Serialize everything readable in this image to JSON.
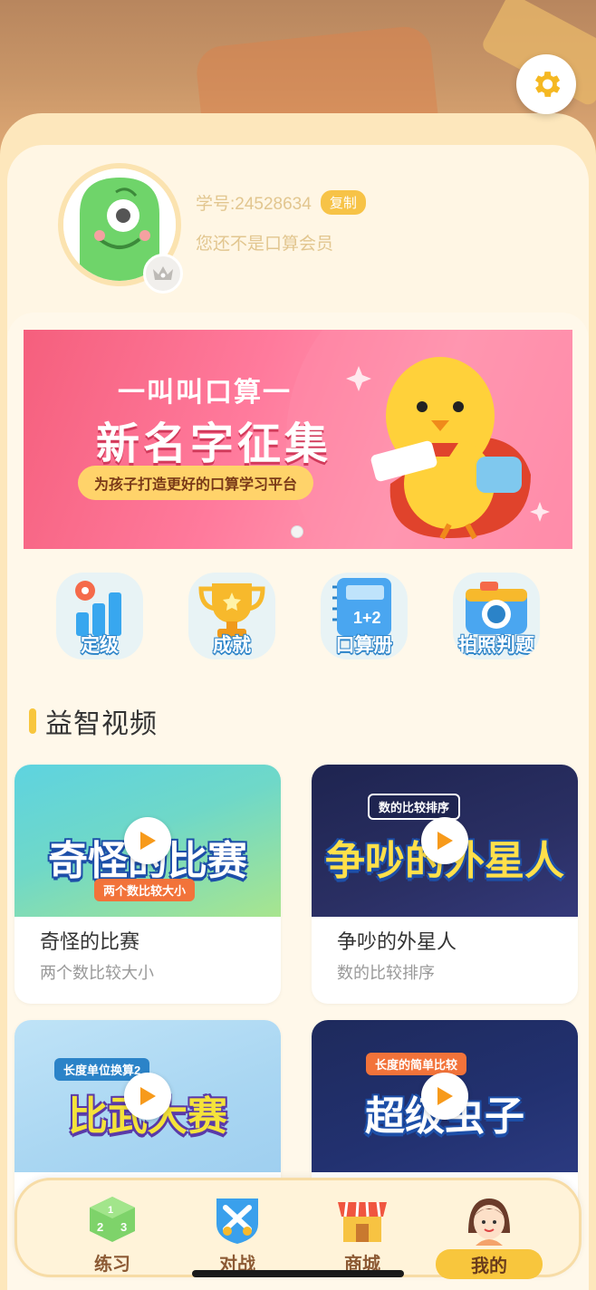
{
  "header": {
    "settings_icon": "gear-icon"
  },
  "profile": {
    "student_id": "学号:24528634",
    "copy_label": "复制",
    "member_status": "您还不是口算会员"
  },
  "banner": {
    "subtitle": "一叫叫口算一",
    "title": "新名字征集",
    "tagline": "为孩子打造更好的口算学习平台"
  },
  "shortcuts": [
    {
      "label": "定级",
      "icon": "level-chart-icon"
    },
    {
      "label": "成就",
      "icon": "trophy-icon"
    },
    {
      "label": "口算册",
      "icon": "notebook-icon"
    },
    {
      "label": "拍照判题",
      "icon": "camera-icon"
    }
  ],
  "section": {
    "title": "益智视频"
  },
  "videos": [
    {
      "thumb_title": "奇怪的比赛",
      "thumb_sub": "两个数比较大小",
      "name": "奇怪的比赛",
      "desc": "两个数比较大小"
    },
    {
      "thumb_title": "争吵的外星人",
      "thumb_sub": "数的比较排序",
      "name": "争吵的外星人",
      "desc": "数的比较排序"
    },
    {
      "thumb_title": "比武大赛",
      "thumb_sub": "长度单位换算2",
      "name": "",
      "desc": ""
    },
    {
      "thumb_title": "超级虫子",
      "thumb_sub": "长度的简单比较",
      "name": "",
      "desc": ""
    }
  ],
  "nav": [
    {
      "label": "练习",
      "icon": "dice-icon"
    },
    {
      "label": "对战",
      "icon": "battle-icon"
    },
    {
      "label": "商城",
      "icon": "shop-icon"
    },
    {
      "label": "我的",
      "icon": "profile-avatar-icon"
    }
  ],
  "colors": {
    "accent": "#f8c63d",
    "banner": "#f55f7d",
    "muted_text": "#e2c68f"
  }
}
